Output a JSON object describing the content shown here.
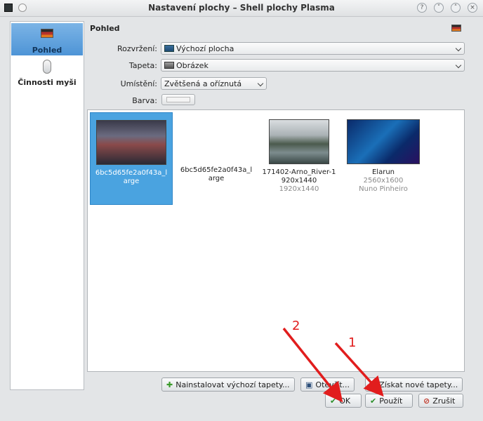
{
  "window": {
    "title": "Nastavení plochy – Shell plochy Plasma"
  },
  "sidebar": {
    "items": [
      {
        "label": "Pohled",
        "icon": "flag-icon",
        "selected": true
      },
      {
        "label": "Činnosti myši",
        "icon": "mouse-icon",
        "selected": false
      }
    ]
  },
  "section": {
    "title": "Pohled"
  },
  "form": {
    "layout_label": "Rozvržení:",
    "layout_value": "Výchozí plocha",
    "wallpaper_label": "Tapeta:",
    "wallpaper_value": "Obrázek",
    "position_label": "Umístění:",
    "position_value": "Zvětšená a oříznutá",
    "color_label": "Barva:"
  },
  "wallpapers": [
    {
      "name": "6bc5d65fe2a0f43a_large",
      "meta": "",
      "selected": true,
      "thumb": "times-square"
    },
    {
      "name": "6bc5d65fe2a0f43a_large",
      "meta": "",
      "selected": false,
      "thumb": "none"
    },
    {
      "name": "171402-Arno_River-1920x1440",
      "meta": "1920x1440",
      "selected": false,
      "thumb": "river"
    },
    {
      "name": "Elarun",
      "meta": "2560x1600",
      "meta2": "Nuno Pinheiro",
      "selected": false,
      "thumb": "elarun"
    }
  ],
  "buttons": {
    "install_default": "Nainstalovat výchozí tapety...",
    "open": "Otevřít...",
    "get_new": "Získat nové tapety...",
    "ok": "OK",
    "apply": "Použít",
    "cancel": "Zrušit"
  },
  "annotations": {
    "one": "1",
    "two": "2"
  },
  "colors": {
    "accent": "#4aa3e0",
    "annotation": "#e11d1d"
  }
}
